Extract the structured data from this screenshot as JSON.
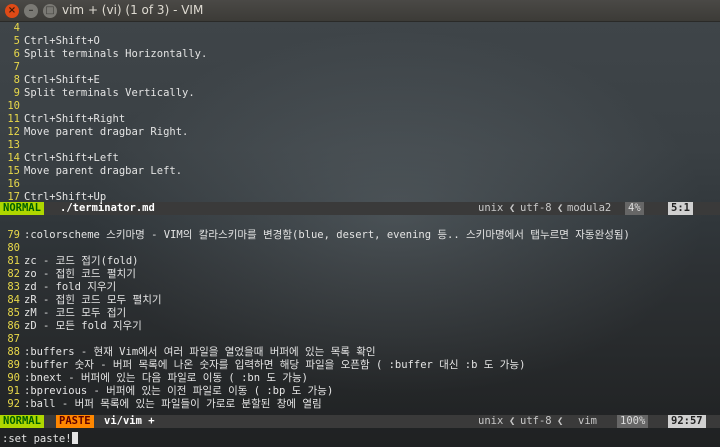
{
  "window": {
    "title": "vim + (vi) (1 of 3) - VIM"
  },
  "top_pane": {
    "lines": [
      {
        "n": "4",
        "t": ""
      },
      {
        "n": "5",
        "t": "Ctrl+Shift+O"
      },
      {
        "n": "6",
        "t": "Split terminals Horizontally."
      },
      {
        "n": "7",
        "t": ""
      },
      {
        "n": "8",
        "t": "Ctrl+Shift+E"
      },
      {
        "n": "9",
        "t": "Split terminals Vertically."
      },
      {
        "n": "10",
        "t": ""
      },
      {
        "n": "11",
        "t": "Ctrl+Shift+Right"
      },
      {
        "n": "12",
        "t": "Move parent dragbar Right."
      },
      {
        "n": "13",
        "t": ""
      },
      {
        "n": "14",
        "t": "Ctrl+Shift+Left"
      },
      {
        "n": "15",
        "t": "Move parent dragbar Left."
      },
      {
        "n": "16",
        "t": ""
      },
      {
        "n": "17",
        "t": "Ctrl+Shift+Up"
      }
    ],
    "status": {
      "mode": "NORMAL",
      "file": "./terminator.md",
      "format": "unix",
      "encoding": "utf-8",
      "filetype": "modula2",
      "percent": "4%",
      "position": "5:1"
    }
  },
  "bottom_pane": {
    "lines": [
      {
        "n": "",
        "t": ""
      },
      {
        "n": "79",
        "t": ":colorscheme 스키마명 - VIM의 칼라스키마를 변경함(blue, desert, evening 등.. 스키마명에서 탭누르면 자동완성됨)"
      },
      {
        "n": "80",
        "t": ""
      },
      {
        "n": "81",
        "t": "zc - 코드 접기(fold)"
      },
      {
        "n": "82",
        "t": "zo - 접힌 코드 펼치기"
      },
      {
        "n": "83",
        "t": "zd - fold 지우기"
      },
      {
        "n": "84",
        "t": "zR - 접힌 코드 모두 펼치기"
      },
      {
        "n": "85",
        "t": "zM - 코드 모두 접기"
      },
      {
        "n": "86",
        "t": "zD - 모든 fold 지우기"
      },
      {
        "n": "87",
        "t": ""
      },
      {
        "n": "88",
        "t": ":buffers - 현재 Vim에서 여러 파일을 열었을때 버퍼에 있는 목록 확인"
      },
      {
        "n": "89",
        "t": ":buffer 숫자 - 버퍼 목록에 나온 숫자를 입력하면 해당 파일을 오픈함 ( :buffer 대신 :b 도 가능)"
      },
      {
        "n": "90",
        "t": ":bnext - 버퍼에 있는 다음 파일로 이동 ( :bn 도 가능)"
      },
      {
        "n": "91",
        "t": ":bprevious - 버퍼에 있는 이전 파일로 이동 ( :bp 도 가능)"
      },
      {
        "n": "92",
        "t": ":ball - 버퍼 목록에 있는 파일들이 가로로 분할된 창에 열림"
      }
    ],
    "status": {
      "mode": "NORMAL",
      "paste": "PASTE",
      "file": "vi/vim +",
      "format": "unix",
      "encoding": "utf-8",
      "filetype": "vim",
      "percent": "100%",
      "position": "92:57"
    }
  },
  "command_line": ":set paste!"
}
